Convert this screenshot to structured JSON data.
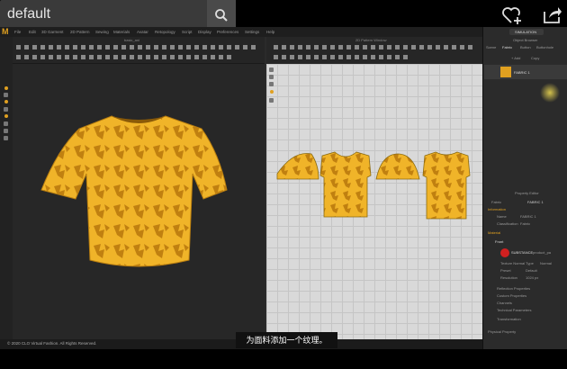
{
  "search": {
    "query": "default"
  },
  "menu": [
    "File",
    "Edit",
    "3D Garment",
    "2D Pattern",
    "Sewing",
    "Materials",
    "Avatar",
    "Retopology",
    "Script",
    "Display",
    "Preferences",
    "Settings",
    "Help"
  ],
  "views": {
    "title_3d": "basic_ani",
    "title_2d": "2D Pattern Window"
  },
  "right_panel": {
    "simulation_label": "SIMULATION",
    "object_browser_title": "Object Browser",
    "tabs": [
      "Scene",
      "Fabric",
      "Button",
      "Buttonhole"
    ],
    "buttons": [
      "+ Add",
      "Copy"
    ],
    "fabric_item": "FABRIC 1",
    "property_editor_title": "Property Editor",
    "fabric_field": "Fabric",
    "fabric_value": "FABRIC 1",
    "sections": [
      "Information",
      "Material",
      "Reflection Properties",
      "Custom Properties",
      "Channels",
      "Technical Parameters",
      "Transformation",
      "Physical Property"
    ],
    "info_rows": [
      {
        "k": "Name",
        "v": "FABRIC 1"
      },
      {
        "k": "Classification",
        "v": "Fabric"
      }
    ],
    "front_tab": "Front",
    "substance_label": "SUBSTANCE",
    "substance_value": "product_pa",
    "mat_rows": [
      {
        "k": "Texture Normal Type",
        "v": "Normal"
      },
      {
        "k": "Preset",
        "v": "Default"
      },
      {
        "k": "Resolution",
        "v": "1024 px"
      }
    ]
  },
  "status": {
    "copyright": "© 2020 CLO Virtual Fashion. All Rights Reserved."
  },
  "subtitle": "为面料添加一个纹理。",
  "colors": {
    "accent": "#e0a020",
    "fabric": "#f0b429",
    "fabric_pattern": "#c08010",
    "pattern_bg": "#d9d9d9"
  }
}
